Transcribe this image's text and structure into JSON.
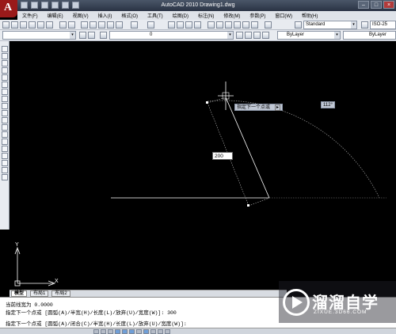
{
  "app": {
    "window_title": "AutoCAD 2010    Drawing1.dwg",
    "logo_letter": "A",
    "window_controls": [
      "–",
      "□",
      "×"
    ]
  },
  "menu": [
    "文件(F)",
    "编辑(E)",
    "视图(V)",
    "插入(I)",
    "格式(O)",
    "工具(T)",
    "绘图(D)",
    "标注(N)",
    "修改(M)",
    "参数(P)",
    "窗口(W)",
    "帮助(H)"
  ],
  "toolbar": {
    "text_style": "Standard",
    "dim_style": "ISO-25",
    "layer": "0",
    "color": "ByLayer",
    "linetype": "ByLayer"
  },
  "canvas": {
    "tooltip_prompt": "指定下一个点或",
    "angle_value": "112°",
    "length_input": "200",
    "ucs_y": "Y",
    "ucs_x": "X"
  },
  "tabs": [
    "模型",
    "布局1",
    "布局2"
  ],
  "command_lines": [
    "当前线宽为 0.0000",
    "指定下一个点或 [圆弧(A)/半宽(H)/长度(L)/放弃(U)/宽度(W)]: 300",
    "指定下一个点或 [圆弧(A)/闭合(C)/半宽(H)/长度(L)/放弃(U)/宽度(W)]:"
  ],
  "watermark": {
    "brand": "溜溜自学",
    "url": "ZIXUE.3D66.COM"
  },
  "colors": {
    "background": "#000000",
    "crosshair": "#ffffff",
    "tooltip": "#c0c7d4"
  }
}
